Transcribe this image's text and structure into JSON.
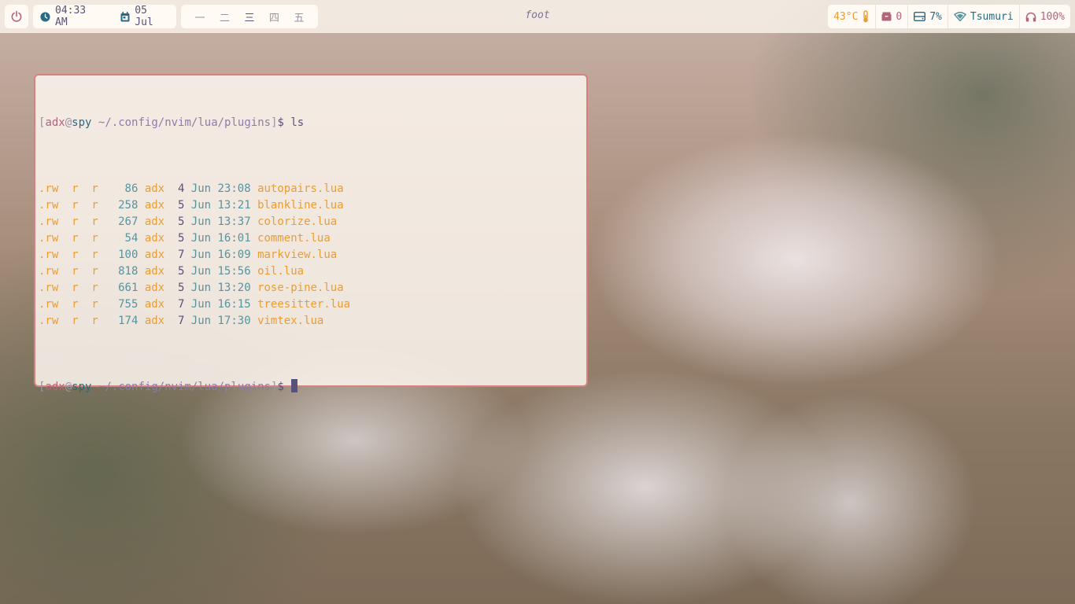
{
  "topbar": {
    "power_icon": "power-icon",
    "time": "04:33 AM",
    "date": "05 Jul",
    "workspaces": [
      "一",
      "二",
      "三",
      "四",
      "五"
    ],
    "active_workspace": 2,
    "window_title": "foot",
    "temperature": "43°C",
    "notifications": "0",
    "disk": "7%",
    "wifi": "Tsumuri",
    "volume": "100%"
  },
  "terminal": {
    "prompt": {
      "user": "adx",
      "at": "@",
      "host": "spy",
      "path": "~/.config/nvim/lua/plugins",
      "symbol": "$"
    },
    "command": "ls",
    "files": [
      {
        "perm": ".rw",
        "g": "r",
        "o": "r",
        "size": "86",
        "user": "adx",
        "day": "4",
        "month": "Jun",
        "time": "23:08",
        "name": "autopairs.lua"
      },
      {
        "perm": ".rw",
        "g": "r",
        "o": "r",
        "size": "258",
        "user": "adx",
        "day": "5",
        "month": "Jun",
        "time": "13:21",
        "name": "blankline.lua"
      },
      {
        "perm": ".rw",
        "g": "r",
        "o": "r",
        "size": "267",
        "user": "adx",
        "day": "5",
        "month": "Jun",
        "time": "13:37",
        "name": "colorize.lua"
      },
      {
        "perm": ".rw",
        "g": "r",
        "o": "r",
        "size": "54",
        "user": "adx",
        "day": "5",
        "month": "Jun",
        "time": "16:01",
        "name": "comment.lua"
      },
      {
        "perm": ".rw",
        "g": "r",
        "o": "r",
        "size": "100",
        "user": "adx",
        "day": "7",
        "month": "Jun",
        "time": "16:09",
        "name": "markview.lua"
      },
      {
        "perm": ".rw",
        "g": "r",
        "o": "r",
        "size": "818",
        "user": "adx",
        "day": "5",
        "month": "Jun",
        "time": "15:56",
        "name": "oil.lua"
      },
      {
        "perm": ".rw",
        "g": "r",
        "o": "r",
        "size": "661",
        "user": "adx",
        "day": "5",
        "month": "Jun",
        "time": "13:20",
        "name": "rose-pine.lua"
      },
      {
        "perm": ".rw",
        "g": "r",
        "o": "r",
        "size": "755",
        "user": "adx",
        "day": "7",
        "month": "Jun",
        "time": "16:15",
        "name": "treesitter.lua"
      },
      {
        "perm": ".rw",
        "g": "r",
        "o": "r",
        "size": "174",
        "user": "adx",
        "day": "7",
        "month": "Jun",
        "time": "17:30",
        "name": "vimtex.lua"
      }
    ]
  },
  "colors": {
    "base": "#faf4ed",
    "surface": "#fffaf3",
    "text": "#575279",
    "love": "#b4637a",
    "gold": "#ea9d34",
    "rose": "#d7827e",
    "pine": "#286983",
    "foam": "#56949f",
    "iris": "#907aa9"
  }
}
